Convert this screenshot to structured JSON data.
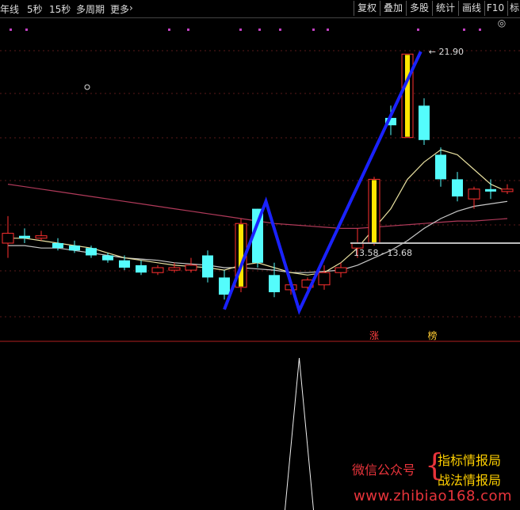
{
  "toolbar": {
    "left_items": [
      "年线",
      "5秒",
      "15秒",
      "多周期",
      "更多"
    ],
    "more_arrow": "›",
    "buttons": [
      "复权",
      "叠加",
      "多股",
      "统计",
      "画线",
      "F10",
      "◎",
      "标"
    ]
  },
  "chart_data": {
    "type": "candlestick",
    "up_color": "#ff3030",
    "down_color": "#54fcfc",
    "limit_up_color": "#ffe600",
    "price_high_label": "21.90",
    "range_label": "13.58 - 13.68",
    "ylim": [
      11.2,
      23.2
    ],
    "candles": [
      {
        "o": 14.2,
        "h": 15.3,
        "l": 13.6,
        "c": 14.6
      },
      {
        "o": 14.5,
        "h": 14.8,
        "l": 14.2,
        "c": 14.4
      },
      {
        "o": 14.4,
        "h": 14.7,
        "l": 14.3,
        "c": 14.5
      },
      {
        "o": 14.2,
        "h": 14.4,
        "l": 13.9,
        "c": 14.0
      },
      {
        "o": 14.1,
        "h": 14.3,
        "l": 13.8,
        "c": 13.9
      },
      {
        "o": 14.0,
        "h": 14.1,
        "l": 13.6,
        "c": 13.7
      },
      {
        "o": 13.7,
        "h": 13.8,
        "l": 13.4,
        "c": 13.5
      },
      {
        "o": 13.5,
        "h": 13.7,
        "l": 13.1,
        "c": 13.2
      },
      {
        "o": 13.3,
        "h": 13.5,
        "l": 12.9,
        "c": 13.0
      },
      {
        "o": 13.0,
        "h": 13.3,
        "l": 12.9,
        "c": 13.2
      },
      {
        "o": 13.1,
        "h": 13.4,
        "l": 13.0,
        "c": 13.2
      },
      {
        "o": 13.1,
        "h": 13.6,
        "l": 13.0,
        "c": 13.3
      },
      {
        "o": 13.7,
        "h": 13.9,
        "l": 12.6,
        "c": 12.8
      },
      {
        "o": 12.8,
        "h": 13.1,
        "l": 11.9,
        "c": 12.1
      },
      {
        "o": 12.4,
        "h": 15.2,
        "l": 12.2,
        "c": 15.0,
        "limit": true
      },
      {
        "o": 15.6,
        "h": 15.6,
        "l": 13.2,
        "c": 13.4
      },
      {
        "o": 12.9,
        "h": 13.4,
        "l": 12.0,
        "c": 12.2
      },
      {
        "o": 12.3,
        "h": 12.6,
        "l": 12.1,
        "c": 12.5
      },
      {
        "o": 12.4,
        "h": 12.8,
        "l": 12.2,
        "c": 12.7
      },
      {
        "o": 12.5,
        "h": 13.3,
        "l": 12.3,
        "c": 13.0
      },
      {
        "o": 13.0,
        "h": 13.4,
        "l": 12.8,
        "c": 13.2
      },
      {
        "o": 14.0,
        "h": 14.8,
        "l": 13.6,
        "c": 14.2
      },
      {
        "o": 14.2,
        "h": 16.9,
        "l": 14.1,
        "c": 16.8,
        "limit": true
      },
      {
        "o": 19.3,
        "h": 19.8,
        "l": 18.6,
        "c": 19.0
      },
      {
        "o": 18.5,
        "h": 21.9,
        "l": 18.5,
        "c": 21.9,
        "limit": true
      },
      {
        "o": 19.8,
        "h": 20.1,
        "l": 18.2,
        "c": 18.4
      },
      {
        "o": 17.8,
        "h": 18.1,
        "l": 16.5,
        "c": 16.8
      },
      {
        "o": 16.8,
        "h": 17.1,
        "l": 15.9,
        "c": 16.1
      },
      {
        "o": 16.0,
        "h": 16.5,
        "l": 15.6,
        "c": 16.4
      },
      {
        "o": 16.4,
        "h": 16.8,
        "l": 16.0,
        "c": 16.3
      },
      {
        "o": 16.3,
        "h": 16.6,
        "l": 16.2,
        "c": 16.4
      }
    ],
    "ma_short": [
      14.4,
      14.4,
      14.3,
      14.2,
      14.1,
      14.0,
      13.8,
      13.6,
      13.5,
      13.4,
      13.3,
      13.25,
      13.2,
      13.1,
      13.3,
      13.4,
      13.2,
      13.0,
      12.9,
      13.0,
      13.4,
      14.0,
      14.8,
      15.6,
      16.8,
      17.5,
      18.0,
      17.8,
      17.2,
      16.6,
      16.3
    ],
    "ma_mid": [
      14.1,
      14.1,
      14.0,
      14.0,
      13.9,
      13.8,
      13.7,
      13.6,
      13.55,
      13.5,
      13.4,
      13.35,
      13.3,
      13.2,
      13.2,
      13.15,
      13.1,
      13.0,
      13.0,
      13.05,
      13.1,
      13.3,
      13.6,
      13.9,
      14.3,
      14.8,
      15.2,
      15.5,
      15.7,
      15.8,
      15.9
    ],
    "ma_long": [
      16.6,
      16.5,
      16.4,
      16.3,
      16.2,
      16.1,
      16.0,
      15.9,
      15.8,
      15.7,
      15.6,
      15.5,
      15.4,
      15.3,
      15.2,
      15.1,
      15.0,
      14.95,
      14.9,
      14.85,
      14.8,
      14.8,
      14.85,
      14.9,
      14.95,
      15.0,
      15.05,
      15.1,
      15.1,
      15.15,
      15.2
    ],
    "w_pattern": [
      {
        "i": 13,
        "price": 11.5
      },
      {
        "i": 15.5,
        "price": 15.9
      },
      {
        "i": 17.5,
        "price": 11.45
      },
      {
        "i": 24.8,
        "price": 22.0
      }
    ],
    "markers": [
      {
        "text": "涨",
        "i": 22,
        "color": "#ff4040"
      },
      {
        "text": "榜",
        "i": 25.5,
        "color": "#ffcc33"
      }
    ],
    "indicator_spike_index": 17.5
  },
  "watermark": {
    "line1": "微信公众号",
    "brace": "{",
    "line2": "指标情报局",
    "line3": "战法情报局",
    "url": "www.zhibiao168.com"
  }
}
